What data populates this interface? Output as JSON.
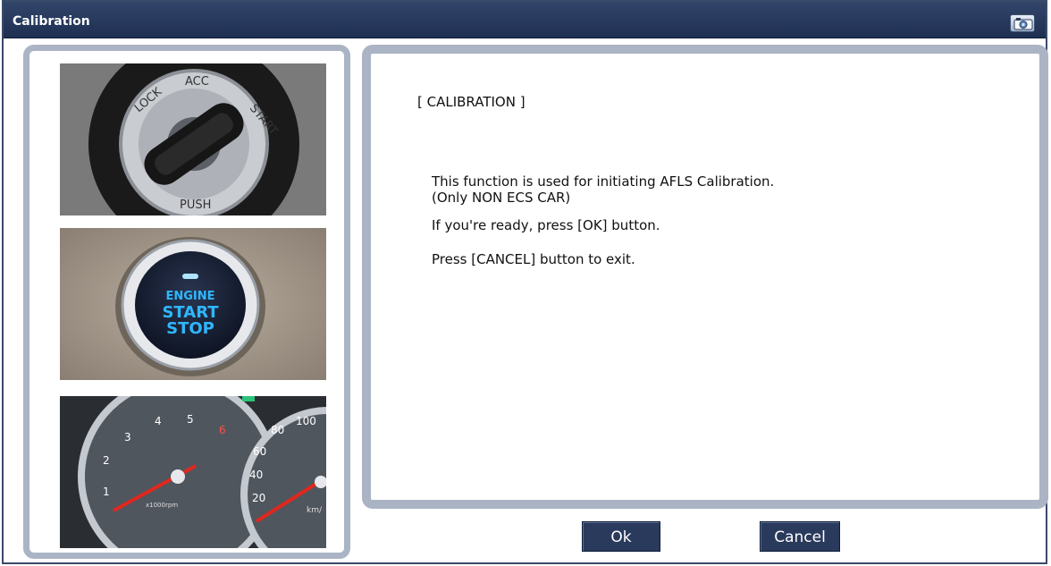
{
  "window": {
    "title": "Calibration"
  },
  "icons": {
    "camera": "camera-icon"
  },
  "images": {
    "ignition_key": {
      "labels": [
        "LOCK",
        "ACC",
        "START",
        "PUSH"
      ]
    },
    "start_button": {
      "labels": [
        "ENGINE",
        "START",
        "STOP"
      ]
    },
    "gauge_cluster": {
      "tach_labels": [
        "1",
        "2",
        "3",
        "4",
        "5",
        "6"
      ],
      "speed_labels": [
        "20",
        "40",
        "60",
        "80",
        "100"
      ],
      "tach_unit": "x1000rpm",
      "speed_unit": "km/"
    }
  },
  "content": {
    "heading": "[ CALIBRATION ]",
    "line1": "This function is used for initiating AFLS Calibration.",
    "line2": "(Only NON ECS CAR)",
    "line3": "If you're ready, press [OK] button.",
    "line4": "Press [CANCEL] button to exit."
  },
  "buttons": {
    "ok": "Ok",
    "cancel": "Cancel"
  },
  "colors": {
    "titlebar": "#1e2f52",
    "panel_border": "#aab4c4",
    "button_bg": "#2a3a5c"
  }
}
